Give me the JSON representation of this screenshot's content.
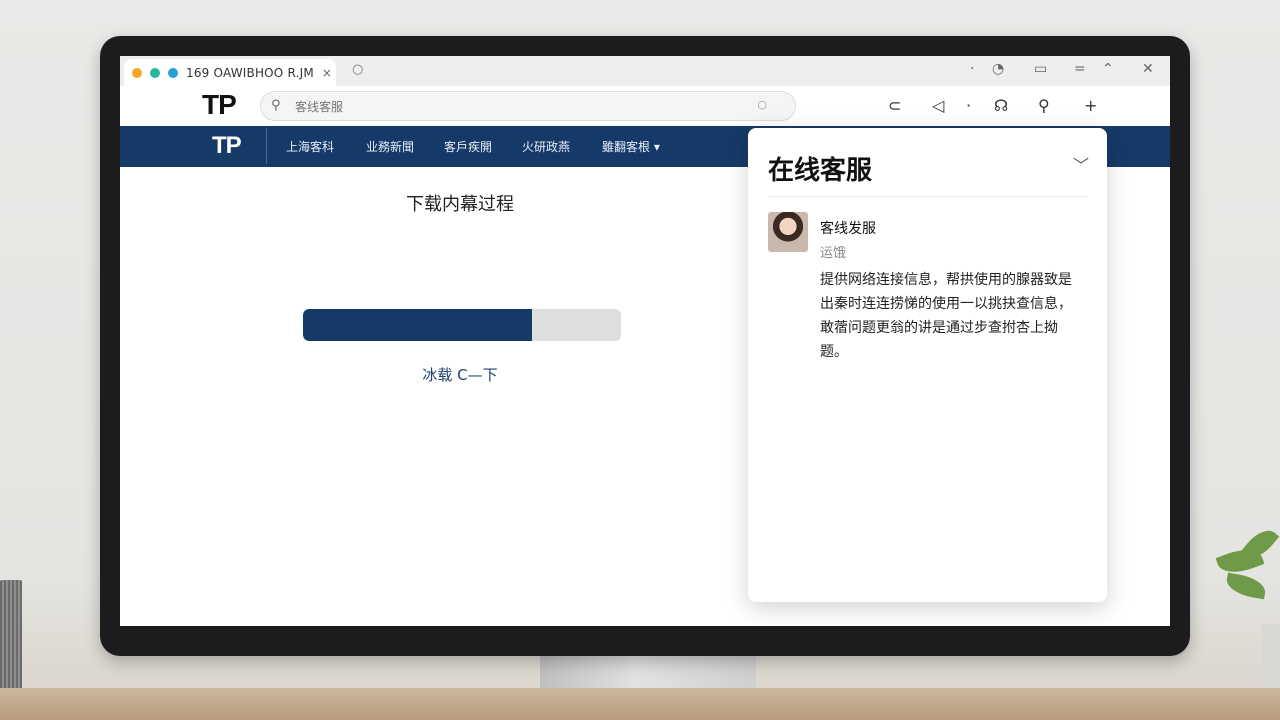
{
  "tabs": [
    {
      "title": "169 OAWIBHOO R.JM",
      "close_glyph": "×"
    }
  ],
  "newtab_glyph": "○",
  "brand": {
    "logo": "TP"
  },
  "search": {
    "placeholder": "客线客服",
    "end_glyph": "○"
  },
  "toolbar_icons": [
    "⊂",
    "◁",
    "·",
    "☊",
    "⚲",
    "+"
  ],
  "nav": {
    "logo": "TP",
    "items": [
      "上海客科",
      "业務新聞",
      "客戶疾開",
      "火研政燕",
      "雖翻客根 ▾"
    ]
  },
  "main": {
    "progress_title": "下载内幕过程",
    "progress_percent": 72,
    "action_label": "冰载 C—下"
  },
  "chat_panel": {
    "title": "在线客服",
    "agent_name": "客线发服",
    "agent_status": "运饿",
    "message": "提供网络连接信息，帮拱使用的腺器致是出秦时连连捞悌的使用一以挑抉查信息，敢蓿问题更翁的讲是通过步查拊杏上拗题。"
  },
  "colors": {
    "nav_bg": "#163a68",
    "progress_fill": "#163a68",
    "progress_track": "#dedede",
    "link": "#1f3f73",
    "favicon_1": "#f5a623",
    "favicon_2": "#2bb3a0",
    "favicon_3": "#2a9fd6"
  }
}
